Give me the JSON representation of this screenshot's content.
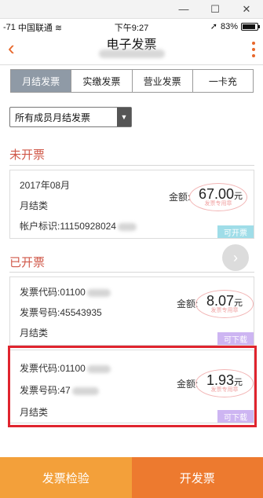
{
  "status": {
    "signal": "-71",
    "carrier": "中国联通",
    "time": "下午9:27",
    "battery": "83%"
  },
  "nav": {
    "back_icon": "‹",
    "title": "电子发票"
  },
  "tabs": [
    {
      "label": "月结发票",
      "active": true
    },
    {
      "label": "实缴发票",
      "active": false
    },
    {
      "label": "营业发票",
      "active": false
    },
    {
      "label": "一卡充",
      "active": false
    }
  ],
  "filter": {
    "selected": "所有成员月结发票"
  },
  "unissued": {
    "title": "未开票",
    "card": {
      "date": "2017年08月",
      "type": "月结类",
      "account_label": "帐户标识:",
      "account_value": "11150928024",
      "amount_label": "金额:",
      "amount": "67.00",
      "unit": "元",
      "stamp": "发票专用章",
      "action": "可开票"
    }
  },
  "issued": {
    "title": "已开票",
    "cards": [
      {
        "code_label": "发票代码:",
        "code_value": "01100",
        "number_label": "发票号码:",
        "number_value": "45543935",
        "type": "月结类",
        "amount_label": "金额:",
        "amount": "8.07",
        "unit": "元",
        "stamp": "发票专用章",
        "action": "可下载"
      },
      {
        "code_label": "发票代码:",
        "code_value": "01100",
        "number_label": "发票号码:",
        "number_value": "47",
        "type": "月结类",
        "amount_label": "金额:",
        "amount": "1.93",
        "unit": "元",
        "stamp": "发票专用章",
        "action": "可下载"
      }
    ]
  },
  "bottom": {
    "check_label": "发票检验",
    "issue_label": "开发票"
  },
  "colors": {
    "accent": "#e8672a",
    "section_title": "#d0594a",
    "highlight": "#e0242e",
    "check_button": "#f3a03a",
    "issue_button": "#ed7a2f"
  }
}
